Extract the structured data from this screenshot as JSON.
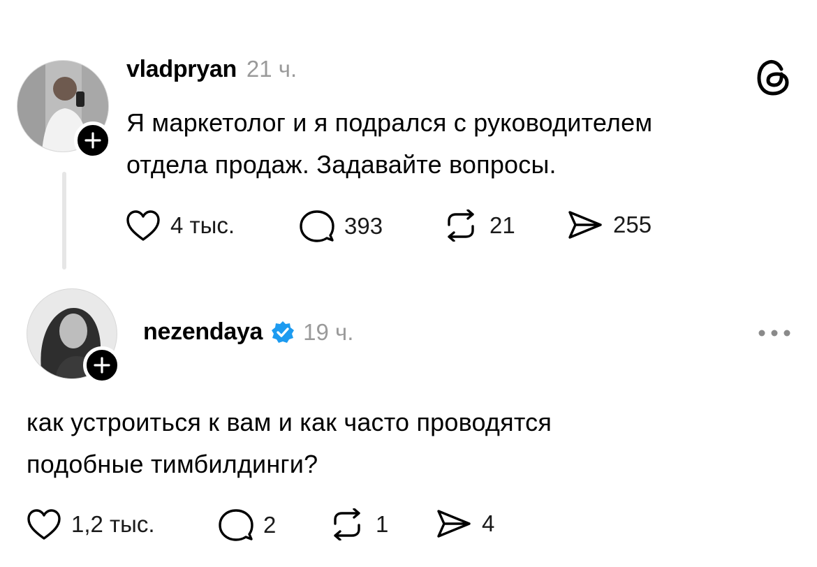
{
  "post": {
    "username": "vladpryan",
    "time": "21 ч.",
    "text_line1": "Я маркетолог и я подрался с руководителем",
    "text_line2": "отдела продаж. Задавайте вопросы.",
    "likes": "4 тыс.",
    "comments": "393",
    "reposts": "21",
    "shares": "255"
  },
  "reply": {
    "username": "nezendaya",
    "verified": true,
    "time": "19 ч.",
    "text_line1": "как устроиться к вам и как часто проводятся",
    "text_line2": "подобные тимбилдинги?",
    "likes": "1,2 тыс.",
    "comments": "2",
    "reposts": "1",
    "shares": "4"
  },
  "colors": {
    "verified_badge": "#1d9bf0",
    "muted_text": "#9a9a9a",
    "thread_line": "#e6e6e6"
  },
  "icons": [
    "threads-logo-icon",
    "heart-icon",
    "comment-icon",
    "repost-icon",
    "share-icon",
    "more-options-icon",
    "plus-icon",
    "verified-icon"
  ]
}
